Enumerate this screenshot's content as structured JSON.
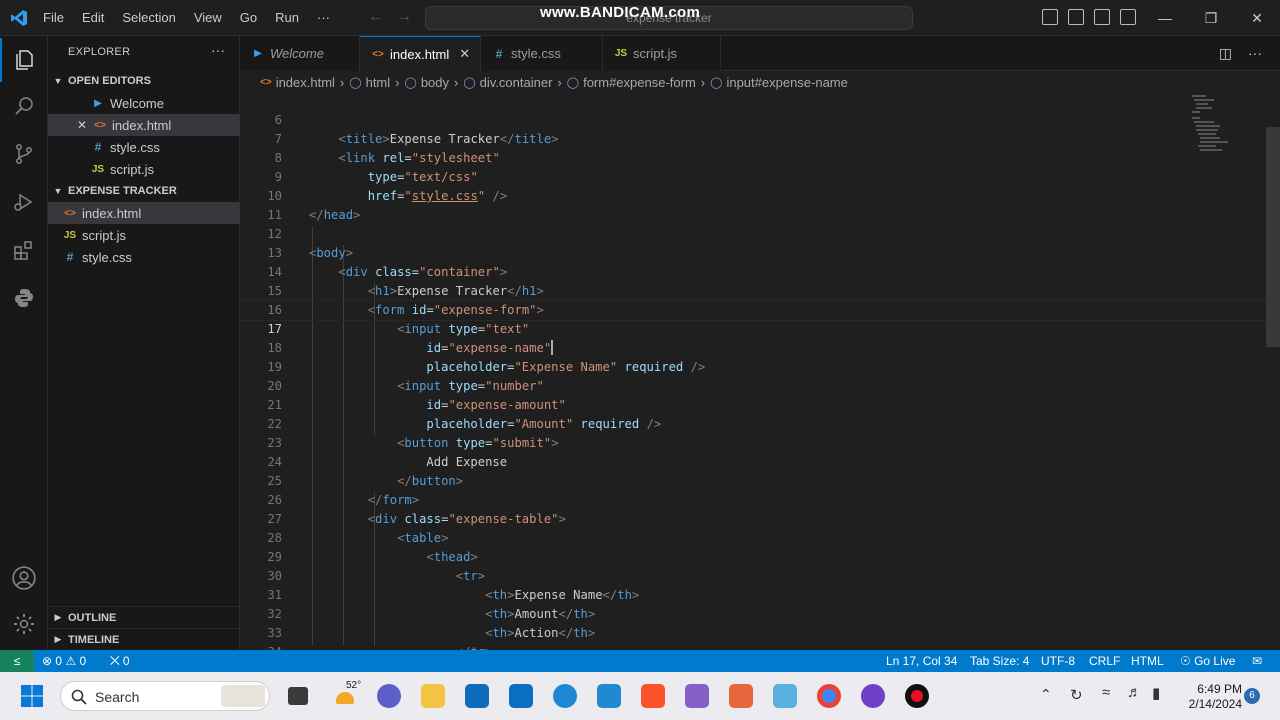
{
  "watermark": "www.BANDICAM.com",
  "titlebar": {
    "menus": [
      "File",
      "Edit",
      "Selection",
      "View",
      "Go",
      "Run",
      "···"
    ],
    "search_text": "expense tracker",
    "window_controls": [
      "—",
      "❐",
      "✕"
    ]
  },
  "sidebar": {
    "title": "EXPLORER",
    "more": "···",
    "open_editors_header": "OPEN EDITORS",
    "open_editors": [
      {
        "name": "Welcome",
        "icon": "vscode-icon",
        "badge": ""
      },
      {
        "name": "index.html",
        "icon": "html-icon",
        "badge": "<>",
        "close": "✕"
      },
      {
        "name": "style.css",
        "icon": "css-icon",
        "badge": "#"
      },
      {
        "name": "script.js",
        "icon": "js-icon",
        "badge": "JS"
      }
    ],
    "project_header": "EXPENSE TRACKER",
    "files": [
      {
        "name": "index.html",
        "badge": "<>"
      },
      {
        "name": "script.js",
        "badge": "JS"
      },
      {
        "name": "style.css",
        "badge": "#"
      }
    ],
    "outline_header": "OUTLINE",
    "timeline_header": "TIMELINE"
  },
  "tabs": [
    {
      "label": "Welcome",
      "badge": ""
    },
    {
      "label": "index.html",
      "badge": "<>",
      "close": "✕"
    },
    {
      "label": "style.css",
      "badge": "#"
    },
    {
      "label": "script.js",
      "badge": "JS"
    }
  ],
  "breadcrumb": [
    "index.html",
    "html",
    "body",
    "div.container",
    "form#expense-form",
    "input#expense-name"
  ],
  "editor": {
    "line_numbers": [
      "6",
      "7",
      "8",
      "9",
      "10",
      "11",
      "12",
      "13",
      "14",
      "15",
      "16",
      "17",
      "18",
      "19",
      "20",
      "21",
      "22",
      "23",
      "24",
      "25",
      "26",
      "27",
      "28",
      "29",
      "30",
      "31",
      "32",
      "33",
      "34"
    ],
    "current_line": "17"
  },
  "statusbar": {
    "problems": "⊗ 0 ⚠ 0",
    "ports": "⨉ 0",
    "position": "Ln 17, Col 34",
    "tab_size": "Tab Size: 4",
    "encoding": "UTF-8",
    "eol": "CRLF",
    "language": "HTML",
    "go_live": "Go Live",
    "colors": {
      "bar": "#007acc",
      "remote": "#16825d"
    }
  },
  "taskbar": {
    "search_placeholder": "Search",
    "weather": "52°",
    "time": "6:49 PM",
    "date": "2/14/2024",
    "notifications": "6"
  }
}
